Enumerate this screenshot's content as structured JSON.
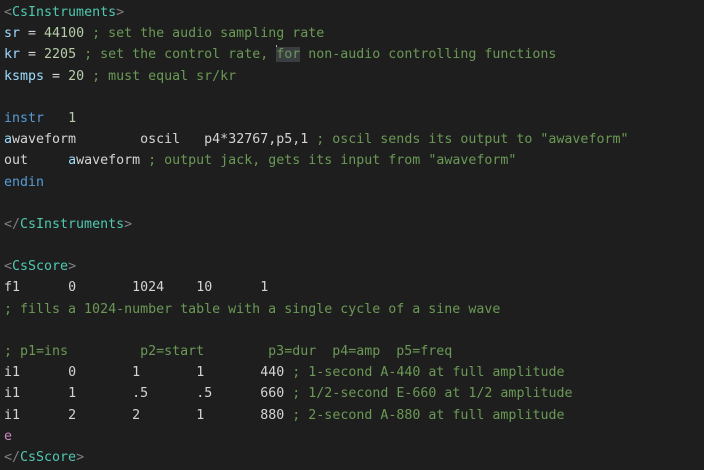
{
  "colors": {
    "background": "#1e1e1e",
    "tag": "#808080",
    "tag_name": "#4ec9b0",
    "variable": "#9cdcfe",
    "keyword": "#569cd6",
    "number": "#b5cea8",
    "comment": "#6a9955",
    "string": "#ce9178",
    "plain": "#d4d4d4",
    "opcode": "#dcdcaa",
    "score_statement": "#c586c0",
    "cursor_selection": "#3a3d41"
  },
  "editor": {
    "lines": [
      [
        {
          "t": "<",
          "c": "tag"
        },
        {
          "t": "CsInstruments",
          "c": "tag_name"
        },
        {
          "t": ">",
          "c": "tag"
        }
      ],
      [
        {
          "t": "sr",
          "c": "variable"
        },
        {
          "t": " = ",
          "c": "plain"
        },
        {
          "t": "44100",
          "c": "number"
        },
        {
          "t": " ; set the audio sampling rate",
          "c": "comment"
        }
      ],
      [
        {
          "t": "kr",
          "c": "variable"
        },
        {
          "t": " = ",
          "c": "plain"
        },
        {
          "t": "2205",
          "c": "number"
        },
        {
          "t": " ; set the control rate, ",
          "c": "comment"
        },
        {
          "t": "for",
          "c": "comment",
          "cursor": true
        },
        {
          "t": " non-audio controlling functions",
          "c": "comment"
        }
      ],
      [
        {
          "t": "ksmps",
          "c": "variable"
        },
        {
          "t": " = ",
          "c": "plain"
        },
        {
          "t": "20",
          "c": "number"
        },
        {
          "t": " ; must equal sr/kr",
          "c": "comment"
        }
      ],
      [],
      [
        {
          "t": "instr",
          "c": "keyword"
        },
        {
          "t": "   ",
          "c": "plain"
        },
        {
          "t": "1",
          "c": "number"
        }
      ],
      [
        {
          "t": "a",
          "c": "variable"
        },
        {
          "t": "waveform",
          "c": "plain"
        },
        {
          "t": "        ",
          "c": "plain"
        },
        {
          "t": "oscil",
          "c": "plain"
        },
        {
          "t": "   ",
          "c": "plain"
        },
        {
          "t": "p4*32767,p5,1",
          "c": "plain"
        },
        {
          "t": " ; oscil sends its output to \"awaveform\"",
          "c": "comment"
        }
      ],
      [
        {
          "t": "out",
          "c": "plain"
        },
        {
          "t": "     ",
          "c": "plain"
        },
        {
          "t": "a",
          "c": "variable"
        },
        {
          "t": "waveform",
          "c": "plain"
        },
        {
          "t": " ; output jack, gets its input from \"awaveform\"",
          "c": "comment"
        }
      ],
      [
        {
          "t": "endin",
          "c": "keyword"
        }
      ],
      [],
      [
        {
          "t": "</",
          "c": "tag"
        },
        {
          "t": "CsInstruments",
          "c": "tag_name"
        },
        {
          "t": ">",
          "c": "tag"
        }
      ],
      [],
      [
        {
          "t": "<",
          "c": "tag"
        },
        {
          "t": "CsScore",
          "c": "tag_name"
        },
        {
          "t": ">",
          "c": "tag"
        }
      ],
      [
        {
          "t": "f1",
          "c": "plain"
        },
        {
          "t": "      ",
          "c": "plain"
        },
        {
          "t": "0",
          "c": "plain"
        },
        {
          "t": "       ",
          "c": "plain"
        },
        {
          "t": "1024",
          "c": "plain"
        },
        {
          "t": "    ",
          "c": "plain"
        },
        {
          "t": "10",
          "c": "plain"
        },
        {
          "t": "      ",
          "c": "plain"
        },
        {
          "t": "1",
          "c": "plain"
        }
      ],
      [
        {
          "t": "; fills a 1024-number table with a single cycle of a sine wave",
          "c": "comment"
        }
      ],
      [],
      [
        {
          "t": "; p1=ins         p2=start        p3=dur  p4=amp  p5=freq",
          "c": "comment"
        }
      ],
      [
        {
          "t": "i1",
          "c": "plain"
        },
        {
          "t": "      ",
          "c": "plain"
        },
        {
          "t": "0",
          "c": "plain"
        },
        {
          "t": "       ",
          "c": "plain"
        },
        {
          "t": "1",
          "c": "plain"
        },
        {
          "t": "       ",
          "c": "plain"
        },
        {
          "t": "1",
          "c": "plain"
        },
        {
          "t": "       ",
          "c": "plain"
        },
        {
          "t": "440",
          "c": "plain"
        },
        {
          "t": " ; 1-second A-440 at full amplitude",
          "c": "comment"
        }
      ],
      [
        {
          "t": "i1",
          "c": "plain"
        },
        {
          "t": "      ",
          "c": "plain"
        },
        {
          "t": "1",
          "c": "plain"
        },
        {
          "t": "       ",
          "c": "plain"
        },
        {
          "t": ".5",
          "c": "plain"
        },
        {
          "t": "      ",
          "c": "plain"
        },
        {
          "t": ".5",
          "c": "plain"
        },
        {
          "t": "      ",
          "c": "plain"
        },
        {
          "t": "660",
          "c": "plain"
        },
        {
          "t": " ; 1/2-second E-660 at 1/2 amplitude",
          "c": "comment"
        }
      ],
      [
        {
          "t": "i1",
          "c": "plain"
        },
        {
          "t": "      ",
          "c": "plain"
        },
        {
          "t": "2",
          "c": "plain"
        },
        {
          "t": "       ",
          "c": "plain"
        },
        {
          "t": "2",
          "c": "plain"
        },
        {
          "t": "       ",
          "c": "plain"
        },
        {
          "t": "1",
          "c": "plain"
        },
        {
          "t": "       ",
          "c": "plain"
        },
        {
          "t": "880",
          "c": "plain"
        },
        {
          "t": " ; 2-second A-880 at full amplitude",
          "c": "comment"
        }
      ],
      [
        {
          "t": "e",
          "c": "score_statement"
        }
      ],
      [
        {
          "t": "</",
          "c": "tag"
        },
        {
          "t": "CsScore",
          "c": "tag_name"
        },
        {
          "t": ">",
          "c": "tag"
        }
      ]
    ]
  }
}
